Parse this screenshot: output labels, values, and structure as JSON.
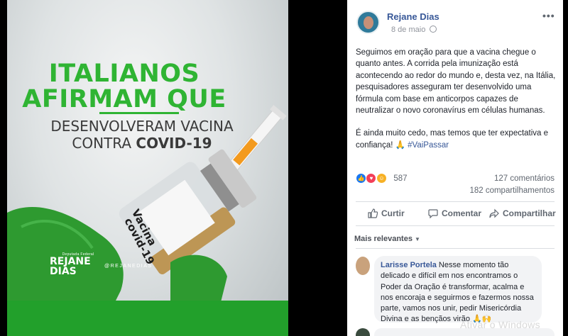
{
  "image_panel": {
    "headline_line1": "ITALIANOS",
    "headline_line2": "AFIRMAM QUE",
    "subline_line1": "DESENVOLVERAM VACINA",
    "subline_prefix": "CONTRA",
    "subline_bold": "COVID-19",
    "vial_label_line1": "Vacina",
    "vial_label_line2": "covid-19",
    "brand_small": "Deputada Federal",
    "brand_name_line1": "REJANE",
    "brand_name_line2": "DIAS",
    "brand_handle": "@REJANEDIAS",
    "colors": {
      "green": "#2fb433",
      "strip": "#22a02b",
      "glove": "#2e9a30"
    }
  },
  "post": {
    "author": "Rejane Dias",
    "date": "8 de maio",
    "more_label": "•••",
    "paragraph1": "Seguimos em oração para que a vacina chegue o quanto antes. A corrida pela imunização está acontecendo ao redor do mundo e, desta vez, na Itália, pesquisadores asseguram ter desenvolvido uma fórmula com base em anticorpos capazes de neutralizar o novo coronavírus em células humanas.",
    "paragraph2_text": "É ainda muito cedo, mas temos que ter expectativa e confiança! 🙏 ",
    "hashtag": "#VaiPassar",
    "reactions_count": "587",
    "comments_count": "127 comentários",
    "shares_count": "182 compartilhamentos",
    "actions": {
      "like": "Curtir",
      "comment": "Comentar",
      "share": "Compartilhar"
    },
    "filter_label": "Mais relevantes"
  },
  "comment": {
    "author": "Larisse Portela",
    "text": " Nesse momento tão delicado e difícil em nos encontramos o Poder da Oração é transformar, acalma e nos encoraja e seguirmos e fazermos nossa parte, vamos nos unir, pedir Misericórdia Divina e as bençãos virão 🙏🙌"
  },
  "watermark": "Ativar o Windows",
  "colors": {
    "link": "#385898",
    "text": "#1d2129",
    "muted": "#606770"
  }
}
